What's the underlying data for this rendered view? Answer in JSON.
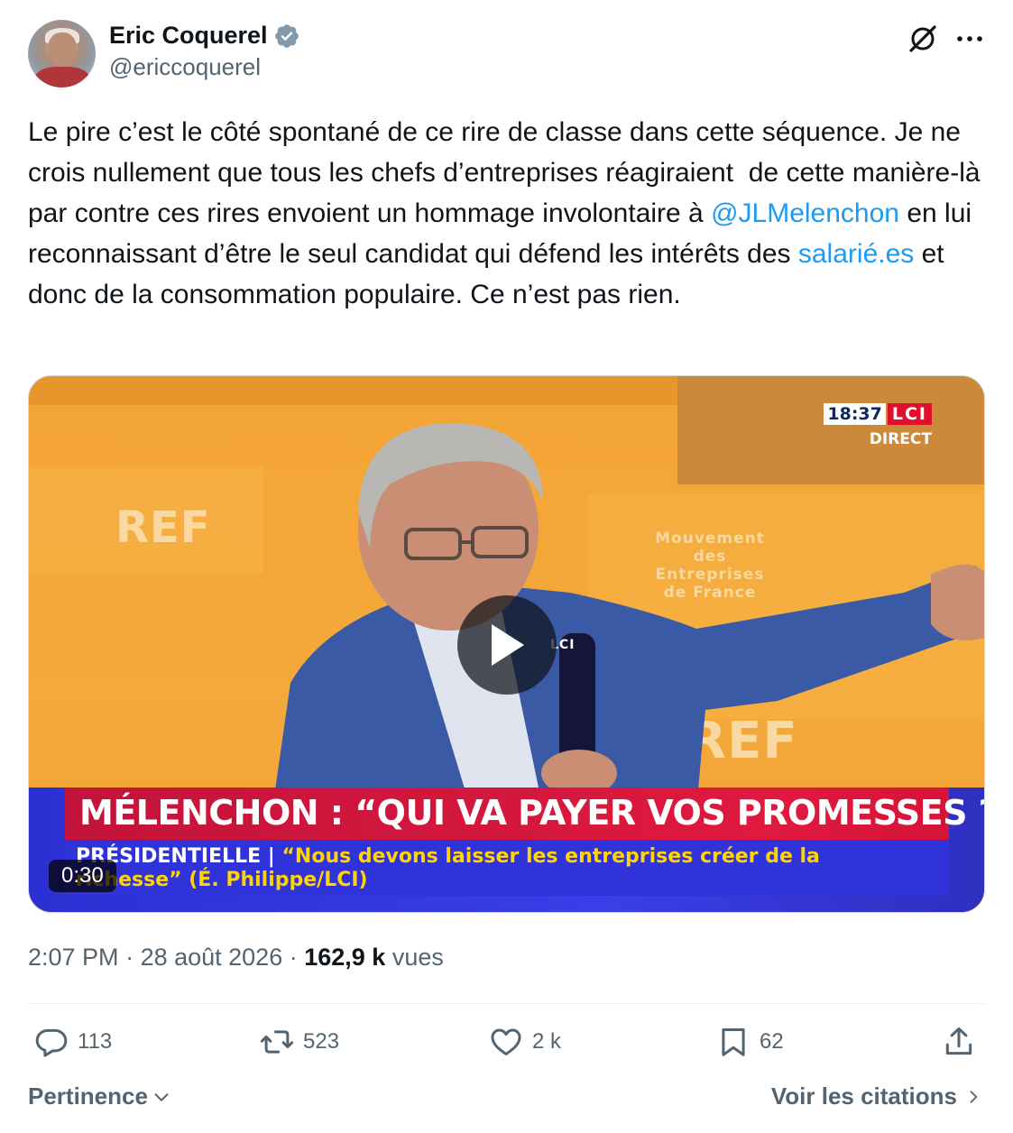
{
  "author": {
    "display_name": "Eric Coquerel",
    "handle": "@ericcoquerel",
    "verified": true,
    "verified_color": "#829aab"
  },
  "tweet": {
    "text_part1": "Le pire c’est le côté spontané de ce rire de classe dans cette séquence. Je ne crois nullement que tous les chefs d’entreprises réagiraient  de cette manière-là par contre ces rires envoient un hommage involontaire à ",
    "mention": "@JLMelenchon",
    "text_part2": " en lui reconnaissant d’être le seul candidat qui défend les intérêts des ",
    "link_text": "salarié.es",
    "text_part3": " et donc de la consommation populaire. Ce n’est pas rien.",
    "link_color": "#1d9bf0"
  },
  "video": {
    "duration": "0:30",
    "overlay_time": "18:37",
    "overlay_channel": "LCI",
    "overlay_live": "DIRECT",
    "headline": "MÉLENCHON : “QUI VA PAYER VOS PROMESSES ? ”",
    "subline_label": "PRÉSIDENTIELLE | ",
    "subline_quote1": "“Nous devons laisser les entreprises créer de la",
    "subline_quote2": "richesse”  (É. Philippe/LCI)",
    "bg_brand_1": "REF",
    "bg_brand_2": "Mouvement des Entreprises de France",
    "mic_label": "LCI"
  },
  "meta": {
    "time": "2:07 PM",
    "separator": " · ",
    "date": "28 août 2026",
    "views_count": "162,9 k",
    "views_label": " vues"
  },
  "actions": {
    "replies": "113",
    "reposts": "523",
    "likes": "2 k",
    "bookmarks": "62"
  },
  "footer": {
    "sort_label": "Pertinence",
    "quotes_label": "Voir les citations"
  },
  "icons": {
    "verified": "verified-badge-icon",
    "grok": "grok-icon",
    "more": "more-icon",
    "reply": "reply-icon",
    "repost": "repost-icon",
    "like": "heart-icon",
    "bookmark": "bookmark-icon",
    "share": "share-icon",
    "play": "play-icon"
  }
}
